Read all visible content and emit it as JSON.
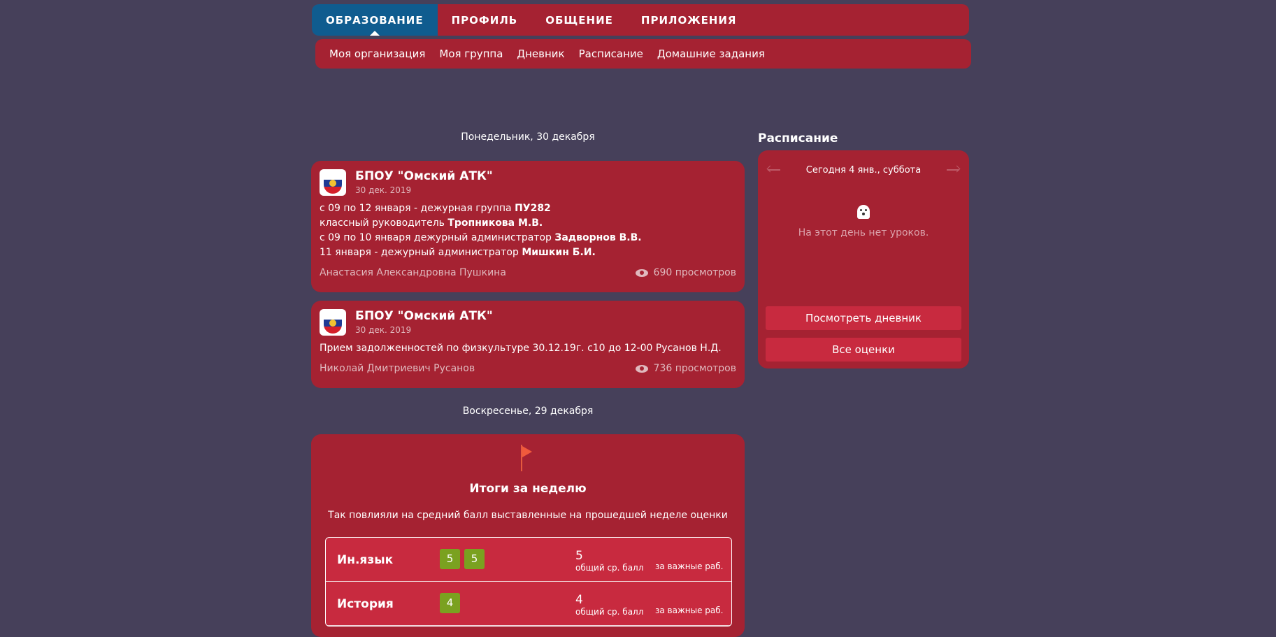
{
  "top_nav": {
    "items": [
      {
        "label": "ОБРАЗОВАНИЕ"
      },
      {
        "label": "ПРОФИЛЬ"
      },
      {
        "label": "ОБЩЕНИЕ"
      },
      {
        "label": "ПРИЛОЖЕНИЯ"
      }
    ]
  },
  "sub_nav": {
    "items": [
      {
        "label": "Моя организация"
      },
      {
        "label": "Моя группа"
      },
      {
        "label": "Дневник"
      },
      {
        "label": "Расписание"
      },
      {
        "label": "Домашние задания"
      }
    ]
  },
  "feed": {
    "days": [
      {
        "label": "Понедельник, 30 декабря"
      },
      {
        "label": "Воскресенье, 29 декабря"
      }
    ],
    "posts": [
      {
        "org": "БПОУ \"Омский АТК\"",
        "date": "30 дек. 2019",
        "lines": [
          {
            "text": "с 09 по 12 января - дежурная группа ",
            "bold": "ПУ282"
          },
          {
            "text": "классный руководитель ",
            "bold": "Тропникова М.В."
          },
          {
            "text": "с 09 по 10 января дежурный администратор ",
            "bold": "Задворнов В.В."
          },
          {
            "text": "11 января - дежурный администратор ",
            "bold": "Мишкин Б.И."
          }
        ],
        "author": "Анастасия Александровна Пушкина",
        "views": "690 просмотров"
      },
      {
        "org": "БПОУ \"Омский АТК\"",
        "date": "30 дек. 2019",
        "lines": [
          {
            "text": "Прием задолженностей по физкультуре 30.12.19г. с10 до 12-00 Русанов Н.Д.",
            "bold": ""
          }
        ],
        "author": "Николай Дмитриевич Русанов",
        "views": "736 просмотров"
      }
    ],
    "week_summary": {
      "title": "Итоги за неделю",
      "subtitle": "Так повлияли на средний балл выставленные на прошедшей неделе оценки",
      "rows": [
        {
          "subject": "Ин.язык",
          "marks": [
            "5",
            "5"
          ],
          "avg": "5",
          "avg_label": "общий ср. балл",
          "important": "за важные раб."
        },
        {
          "subject": "История",
          "marks": [
            "4"
          ],
          "avg": "4",
          "avg_label": "общий ср. балл",
          "important": "за важные раб."
        }
      ]
    }
  },
  "schedule": {
    "title": "Расписание",
    "today": "Сегодня 4 янв., суббота",
    "empty": "На этот день нет уроков.",
    "buttons": {
      "diary": "Посмотреть дневник",
      "grades": "Все оценки"
    }
  },
  "colors": {
    "background": "#46405a",
    "panel": "#a52232",
    "active_tab": "#0f5c8f",
    "button": "#c82a3f",
    "grade_good": "#7aa120"
  }
}
